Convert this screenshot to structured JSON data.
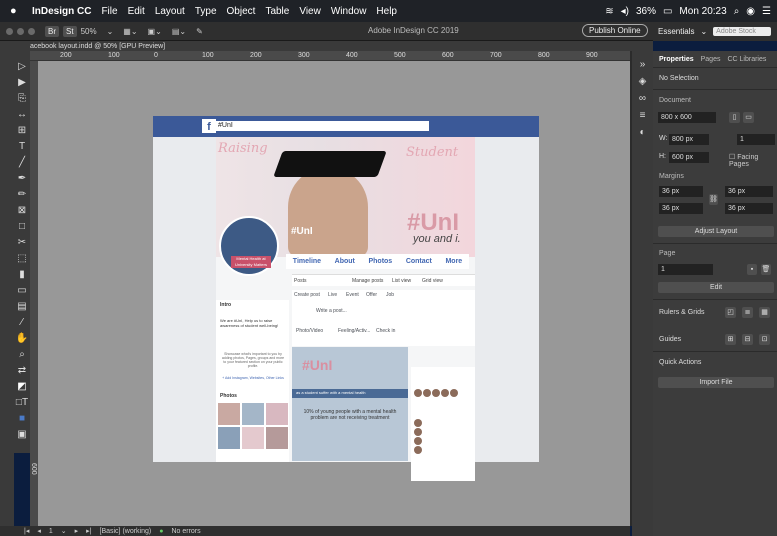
{
  "menubar": {
    "apple": "",
    "app": "InDesign CC",
    "items": [
      "File",
      "Edit",
      "Layout",
      "Type",
      "Object",
      "Table",
      "View",
      "Window",
      "Help"
    ],
    "battery": "36%",
    "clock": "Mon 20:23"
  },
  "titlebar": {
    "br": "Br",
    "st": "St",
    "zoom": "50%",
    "doc_title": "Adobe InDesign CC 2019",
    "publish": "Publish Online"
  },
  "essentials": {
    "label": "Essentials",
    "search_placeholder": "Adobe Stock"
  },
  "tab": {
    "label": "acebook layout.indd @ 50% [GPU Preview]"
  },
  "ruler": {
    "top": [
      "200",
      "100",
      "0",
      "100",
      "200",
      "300",
      "400",
      "500",
      "600",
      "700",
      "800",
      "900"
    ],
    "left": "600"
  },
  "panel": {
    "tabs": [
      "Properties",
      "Pages",
      "CC Libraries"
    ],
    "no_selection": "No Selection",
    "document_heading": "Document",
    "preset": "800 x 600",
    "w_label": "W:",
    "w_value": "800 px",
    "h_label": "H:",
    "h_value": "600 px",
    "pages_value": "1",
    "facing_pages": "Facing Pages",
    "margins_heading": "Margins",
    "margin_values": [
      "36 px",
      "36 px",
      "36 px",
      "36 px"
    ],
    "adjust_layout": "Adjust Layout",
    "page_heading": "Page",
    "page_value": "1",
    "edit": "Edit",
    "rulers_grids": "Rulers & Grids",
    "guides": "Guides",
    "quick_actions": "Quick Actions",
    "import_file": "Import File"
  },
  "status": {
    "page": "1",
    "style": "[Basic] (working)",
    "errors": "No errors"
  },
  "fb": {
    "search_value": "#UnI",
    "cover_title": "#UnI",
    "cover_sub": "you and i.",
    "cover_name": "#UnI",
    "profile_tag": "Mental Health at University Matters",
    "nav": [
      "Timeline",
      "About",
      "Photos",
      "Contact",
      "More"
    ],
    "strip": [
      "Posts",
      "Manage posts",
      "List view",
      "Grid view"
    ],
    "composer": [
      "Create post",
      "Live",
      "Event",
      "Offer",
      "Job"
    ],
    "write_post": "Write a post...",
    "actions": [
      "Photo/Video",
      "Feeling/Activ...",
      "Check in"
    ],
    "intro": "Intro",
    "intro_text": "We are #UnI, Help us to raise awareness of student well-being!",
    "showcase_text": "Showcase what's important to you by adding photos, Pages, groups and more to your featured section on your public profile.",
    "add_featured": "+ Add Instagram, Websites, Other Links",
    "photos": "Photos",
    "post_title": "#UnI",
    "post_band": "as a student suffer with a mental health",
    "post_text": "10% of young people with a mental health problem are not receiving treatment"
  }
}
